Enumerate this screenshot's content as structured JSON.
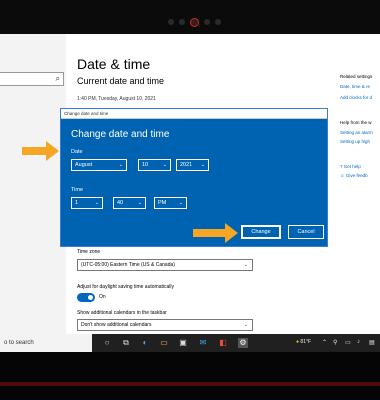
{
  "settings": {
    "page_title": "Date & time",
    "section_title": "Current date and time",
    "current_datetime": "1:40 PM, Tuesday, August 10, 2021",
    "time_zone_label": "Time zone",
    "time_zone_value": "(UTC-05:00) Eastern Time (US & Canada)",
    "dst_label": "Adjust for daylight saving time automatically",
    "dst_state": "On",
    "additional_cal_label": "Show additional calendars in the taskbar",
    "additional_cal_value": "Don't show additional calendars"
  },
  "right_column": {
    "related_heading": "Related settings",
    "related_links": [
      "Date, time & re",
      "Add clocks for d"
    ],
    "help_heading": "Help from the w",
    "help_links": [
      "Setting an alarm",
      "Setting up high"
    ],
    "get_help": "Get help",
    "give_feedback": "Give feedb"
  },
  "dialog": {
    "titlebar": "Change date and time",
    "heading": "Change date and time",
    "date_label": "Date",
    "month": "August",
    "day": "10",
    "year": "2021",
    "time_label": "Time",
    "hour": "1",
    "minute": "40",
    "ampm": "PM",
    "change_label": "Change",
    "cancel_label": "Cancel"
  },
  "taskbar": {
    "search_text": "o to search",
    "weather": "81°F"
  },
  "colors": {
    "dialog_blue": "#0063b1",
    "accent": "#0067c0",
    "arrow_orange": "#f5a623"
  }
}
